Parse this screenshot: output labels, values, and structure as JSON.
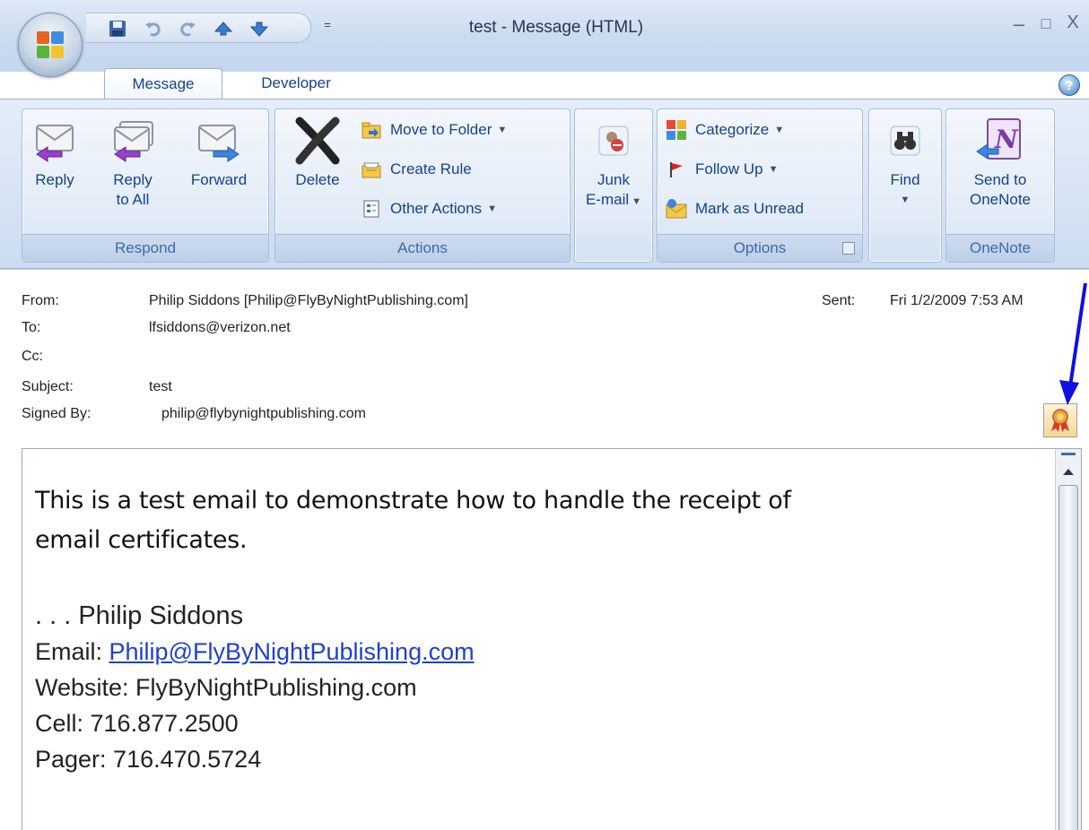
{
  "window": {
    "title": "test - Message (HTML)",
    "controls": {
      "minimize": "–",
      "maximize": "□",
      "close": "X"
    }
  },
  "quick_access": {
    "icons": [
      "save-icon",
      "undo-icon",
      "redo-icon",
      "previous-item-icon",
      "next-item-icon"
    ],
    "more": "="
  },
  "tabs": [
    {
      "label": "Message",
      "active": true
    },
    {
      "label": "Developer",
      "active": false
    }
  ],
  "ribbon": {
    "respond": {
      "label": "Respond",
      "reply": "Reply",
      "reply_all_line1": "Reply",
      "reply_all_line2": "to All",
      "forward": "Forward"
    },
    "actions": {
      "label": "Actions",
      "delete": "Delete",
      "move_to_folder": "Move to Folder",
      "create_rule": "Create Rule",
      "other_actions": "Other Actions"
    },
    "junk": {
      "line1": "Junk",
      "line2": "E-mail"
    },
    "options": {
      "label": "Options",
      "categorize": "Categorize",
      "follow_up": "Follow Up",
      "mark_as_unread": "Mark as Unread"
    },
    "find": {
      "label": "Find"
    },
    "onenote": {
      "label": "OneNote",
      "line1": "Send to",
      "line2": "OneNote"
    }
  },
  "header": {
    "from_label": "From:",
    "from_value": "Philip Siddons [Philip@FlyByNightPublishing.com]",
    "sent_label": "Sent:",
    "sent_value": "Fri 1/2/2009 7:53 AM",
    "to_label": "To:",
    "to_value": "lfsiddons@verizon.net",
    "cc_label": "Cc:",
    "cc_value": "",
    "subject_label": "Subject:",
    "subject_value": "test",
    "signed_by_label": "Signed By:",
    "signed_by_value": "philip@flybynightpublishing.com"
  },
  "body": {
    "line1": "This is a test email to demonstrate how to handle the receipt of",
    "line2": "email certificates.",
    "signature_name": ". . . Philip Siddons",
    "email_label": "Email: ",
    "email_link": "Philip@FlyByNightPublishing.com",
    "website": "Website: FlyByNightPublishing.com",
    "cell": "Cell: 716.877.2500",
    "pager": "Pager: 716.470.5724"
  },
  "colors": {
    "ribbon_text": "#15428b",
    "link": "#1f3fd4",
    "annotation_arrow": "#1010e0"
  }
}
